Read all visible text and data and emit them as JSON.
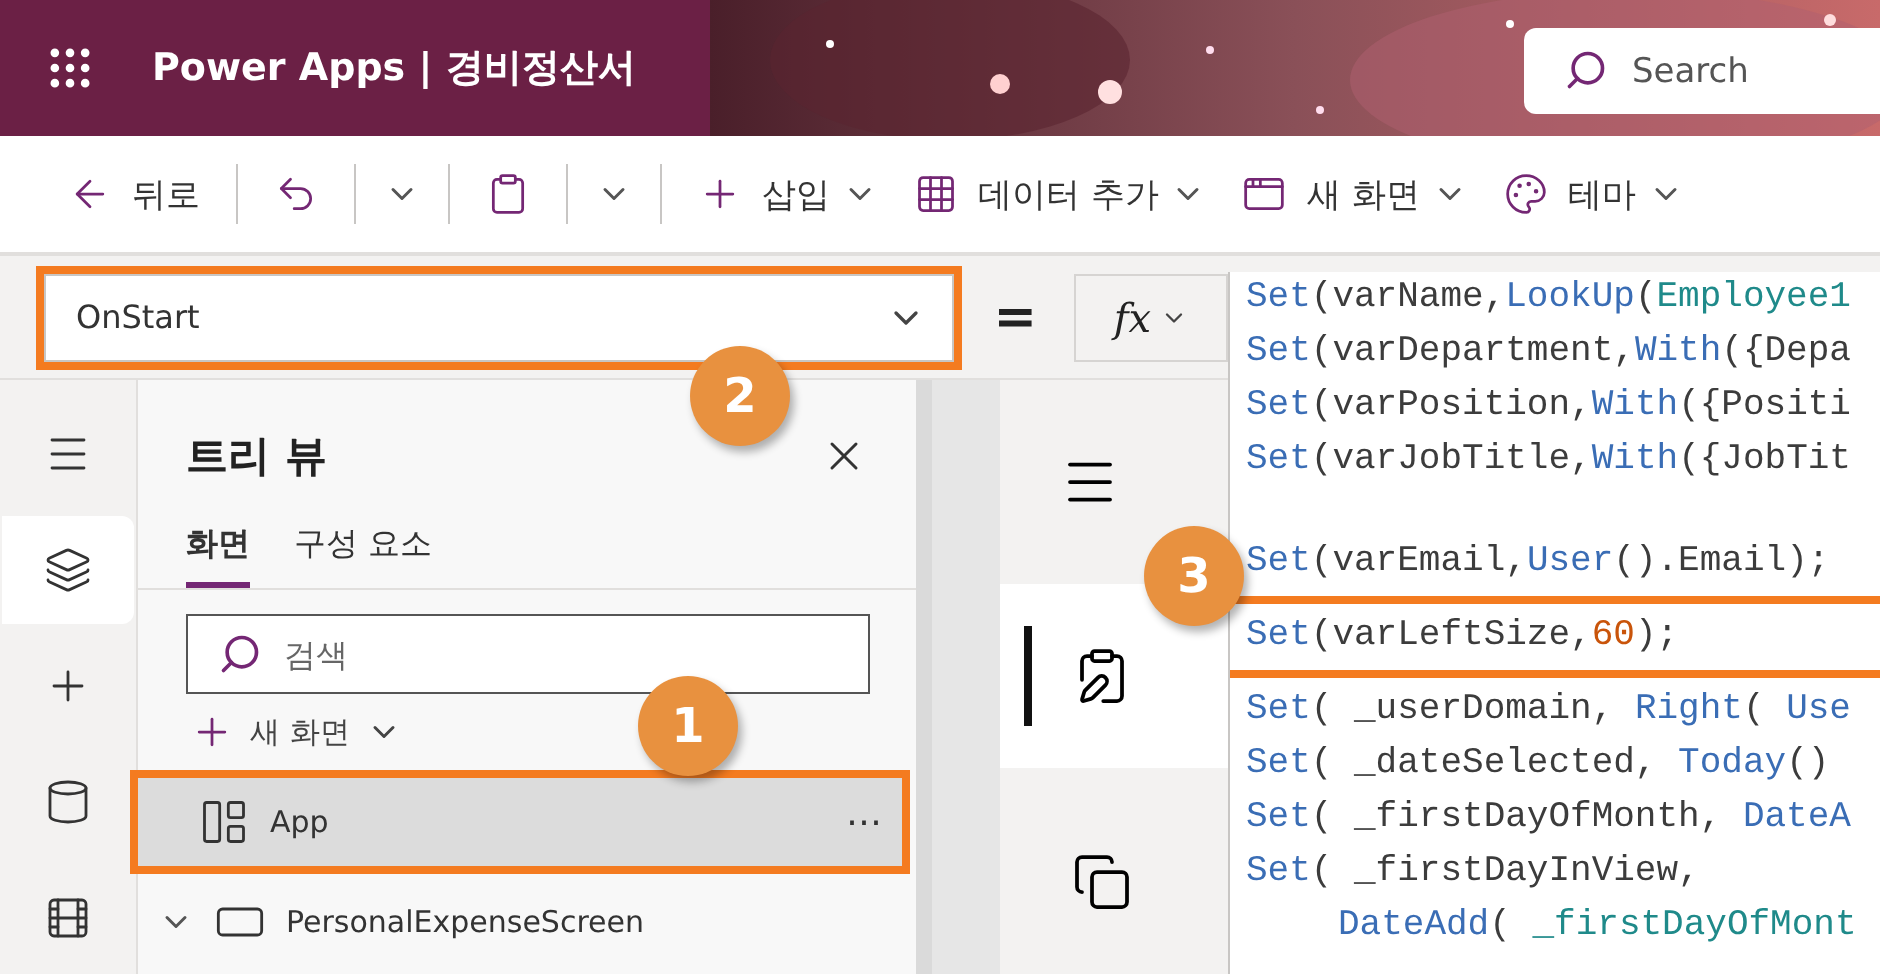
{
  "header": {
    "app_name": "Power Apps",
    "separator": "|",
    "document": "경비정산서",
    "search": {
      "placeholder": "Search"
    }
  },
  "toolbar": [
    {
      "kind": "back",
      "label": "뒤로",
      "dropdown": false,
      "divider_after": true
    },
    {
      "kind": "undo",
      "dropdown": true,
      "divider_after": true
    },
    {
      "kind": "paste",
      "dropdown": true,
      "divider_after": true
    },
    {
      "kind": "insert",
      "label": "삽입",
      "dropdown": true,
      "divider_after": false
    },
    {
      "kind": "data",
      "label": "데이터 추가",
      "dropdown": true,
      "divider_after": false
    },
    {
      "kind": "screen",
      "label": "새 화면",
      "dropdown": true,
      "divider_after": false
    },
    {
      "kind": "theme",
      "label": "테마",
      "dropdown": true,
      "divider_after": false
    }
  ],
  "formula_bar": {
    "property": "OnStart",
    "highlighted": true,
    "equals": "=",
    "fx": "fx"
  },
  "rail": [
    {
      "kind": "menu",
      "selected": false
    },
    {
      "kind": "layers",
      "selected": true
    },
    {
      "kind": "insert",
      "selected": false
    },
    {
      "kind": "data",
      "selected": false
    },
    {
      "kind": "media",
      "selected": false
    }
  ],
  "tree_panel": {
    "title": "트리 뷰",
    "tabs": [
      {
        "label": "화면",
        "selected": true
      },
      {
        "label": "구성 요소",
        "selected": false
      }
    ],
    "search": {
      "placeholder": "검색"
    },
    "new_screen": "새 화면",
    "items": [
      {
        "kind": "app",
        "label": "App",
        "selected": true,
        "highlighted": true,
        "more": "⋯"
      },
      {
        "kind": "screen",
        "label": "PersonalExpenseScreen",
        "selected": false,
        "highlighted": false,
        "expanded": true
      }
    ]
  },
  "canvas_screens": [
    {
      "kind": "form",
      "selected": true
    },
    {
      "kind": "copy",
      "selected": false
    }
  ],
  "code": {
    "blocks": [
      [
        {
          "highlighted": false,
          "indented": false,
          "tokens": [
            {
              "kind": "fn",
              "text": "Set"
            },
            {
              "kind": "text",
              "text": "(varName,"
            },
            {
              "kind": "fn",
              "text": "LookUp"
            },
            {
              "kind": "text",
              "text": "("
            },
            {
              "kind": "ref",
              "text": "Employee1"
            }
          ]
        },
        {
          "highlighted": false,
          "indented": false,
          "tokens": [
            {
              "kind": "fn",
              "text": "Set"
            },
            {
              "kind": "text",
              "text": "(varDepartment,"
            },
            {
              "kind": "fn",
              "text": "With"
            },
            {
              "kind": "text",
              "text": "({Depa"
            }
          ]
        },
        {
          "highlighted": false,
          "indented": false,
          "tokens": [
            {
              "kind": "fn",
              "text": "Set"
            },
            {
              "kind": "text",
              "text": "(varPosition,"
            },
            {
              "kind": "fn",
              "text": "With"
            },
            {
              "kind": "text",
              "text": "({Positi"
            }
          ]
        },
        {
          "highlighted": false,
          "indented": false,
          "tokens": [
            {
              "kind": "fn",
              "text": "Set"
            },
            {
              "kind": "text",
              "text": "(varJobTitle,"
            },
            {
              "kind": "fn",
              "text": "With"
            },
            {
              "kind": "text",
              "text": "({JobTit"
            }
          ]
        }
      ],
      [
        {
          "highlighted": false,
          "indented": false,
          "tokens": [
            {
              "kind": "fn",
              "text": "Set"
            },
            {
              "kind": "text",
              "text": "(varEmail,"
            },
            {
              "kind": "fn",
              "text": "User"
            },
            {
              "kind": "text",
              "text": "().Email);"
            }
          ]
        },
        {
          "highlighted": true,
          "indented": false,
          "tokens": [
            {
              "kind": "fn",
              "text": "Set"
            },
            {
              "kind": "text",
              "text": "(varLeftSize,"
            },
            {
              "kind": "num",
              "text": "60"
            },
            {
              "kind": "text",
              "text": ");"
            }
          ]
        },
        {
          "highlighted": false,
          "indented": false,
          "tokens": [
            {
              "kind": "fn",
              "text": "Set"
            },
            {
              "kind": "text",
              "text": "( _userDomain, "
            },
            {
              "kind": "fn",
              "text": "Right"
            },
            {
              "kind": "text",
              "text": "( "
            },
            {
              "kind": "fn",
              "text": "Use"
            }
          ]
        },
        {
          "highlighted": false,
          "indented": false,
          "tokens": [
            {
              "kind": "fn",
              "text": "Set"
            },
            {
              "kind": "text",
              "text": "( _dateSelected, "
            },
            {
              "kind": "fn",
              "text": "Today"
            },
            {
              "kind": "text",
              "text": "()"
            }
          ]
        },
        {
          "highlighted": false,
          "indented": false,
          "tokens": [
            {
              "kind": "fn",
              "text": "Set"
            },
            {
              "kind": "text",
              "text": "( _firstDayOfMonth, "
            },
            {
              "kind": "fn",
              "text": "DateA"
            }
          ]
        },
        {
          "highlighted": false,
          "indented": false,
          "tokens": [
            {
              "kind": "fn",
              "text": "Set"
            },
            {
              "kind": "text",
              "text": "( _firstDayInView,"
            }
          ]
        },
        {
          "highlighted": false,
          "indented": true,
          "tokens": [
            {
              "kind": "fn",
              "text": "DateAdd"
            },
            {
              "kind": "text",
              "text": "( "
            },
            {
              "kind": "ref",
              "text": "_firstDayOfMont"
            }
          ]
        }
      ]
    ]
  },
  "callouts": [
    {
      "number": "2"
    },
    {
      "number": "1"
    },
    {
      "number": "3"
    }
  ]
}
